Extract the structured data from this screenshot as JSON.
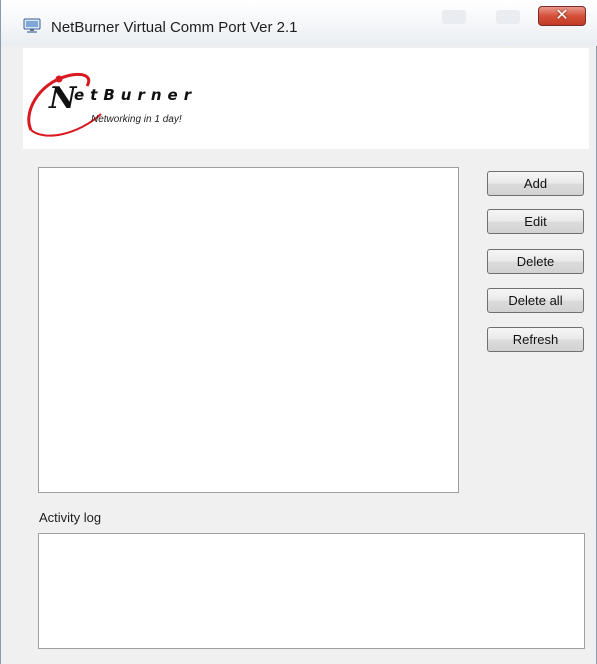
{
  "window": {
    "title": "NetBurner Virtual Comm Port Ver 2.1",
    "close_glyph": "✕"
  },
  "logo": {
    "brand": "etBurner",
    "tagline": "Networking in 1 day!"
  },
  "actions": {
    "add_label": "Add",
    "edit_label": "Edit",
    "delete_label": "Delete",
    "delete_all_label": "Delete all",
    "refresh_label": "Refresh"
  },
  "activity": {
    "label": "Activity log"
  },
  "ports": [],
  "icons": {
    "app": "computer-monitor-icon",
    "close": "close-icon",
    "logo_swoosh": "netburner-swoosh-icon"
  },
  "colors": {
    "logo_red": "#d8191f",
    "close_red": "#c8432d",
    "window_bg": "#f0f0f0"
  }
}
